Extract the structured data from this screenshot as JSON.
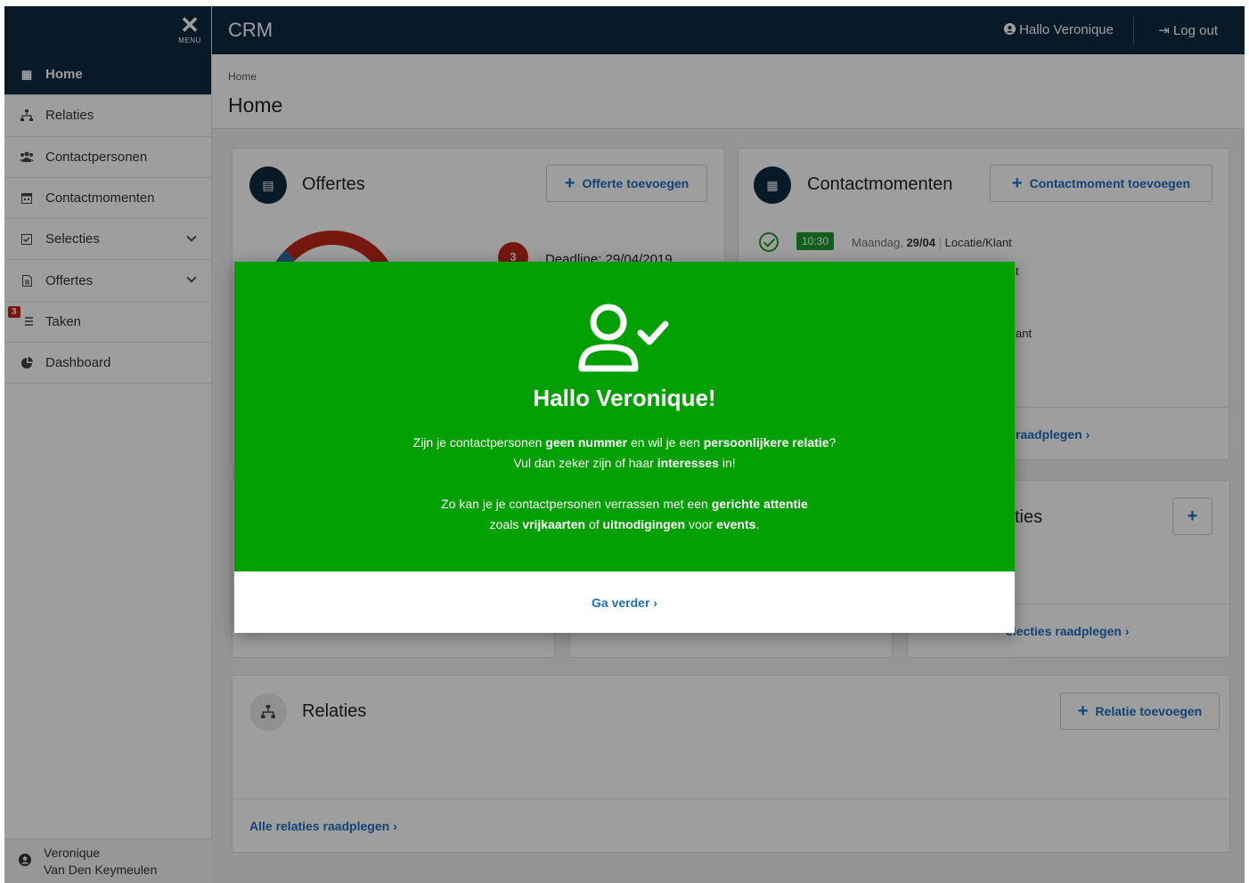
{
  "sidebar": {
    "menu_label": "MENU",
    "items": [
      {
        "label": "Home"
      },
      {
        "label": "Relaties"
      },
      {
        "label": "Contactpersonen"
      },
      {
        "label": "Contactmomenten"
      },
      {
        "label": "Selecties"
      },
      {
        "label": "Offertes"
      },
      {
        "label": "Taken",
        "badge": "3"
      },
      {
        "label": "Dashboard"
      }
    ],
    "user_line1": "Veronique",
    "user_line2": "Van Den Keymeulen"
  },
  "topbar": {
    "app_title": "CRM",
    "hello": "Hallo Veronique",
    "logout": "Log out"
  },
  "page": {
    "breadcrumb": "Home",
    "title": "Home"
  },
  "offertes": {
    "title": "Offertes",
    "add_label": "Offerte toevoegen",
    "count": "3",
    "deadline": "Deadline: 29/04/2019"
  },
  "contactmomenten": {
    "title": "Contactmomenten",
    "add_label": "Contactmoment toevoegen",
    "time": "10:30",
    "day": "Maandag,",
    "date": "29/04",
    "location": "Locatie/Klant",
    "partial_1": "t",
    "partial_2": "ant",
    "link": "raadplegen"
  },
  "selecties": {
    "partial_title": "ties",
    "link": "electies raadplegen"
  },
  "relaties": {
    "title": "Relaties",
    "add_label": "Relatie toevoegen",
    "link": "Alle relaties raadplegen"
  },
  "modal": {
    "title": "Hallo Veronique!",
    "p1_a": "Zijn je contactpersonen ",
    "p1_b": "geen nummer",
    "p1_c": " en wil je een ",
    "p1_d": "persoonlijkere relatie",
    "p1_e": "?",
    "p2_a": "Vul dan zeker zijn of haar ",
    "p2_b": "interesses",
    "p2_c": " in!",
    "p3_a": "Zo kan je je contactpersonen verrassen met een ",
    "p3_b": "gerichte attentie",
    "p4_a": "zoals ",
    "p4_b": "vrijkaarten",
    "p4_c": " of ",
    "p4_d": "uitnodigingen",
    "p4_e": " voor ",
    "p4_f": "events",
    "p4_g": ".",
    "continue": "Ga verder"
  },
  "colors": {
    "navy": "#0d2a40",
    "modal_green": "#02a002",
    "link_blue": "#1a6fbf",
    "badge_red": "#c0271b"
  }
}
